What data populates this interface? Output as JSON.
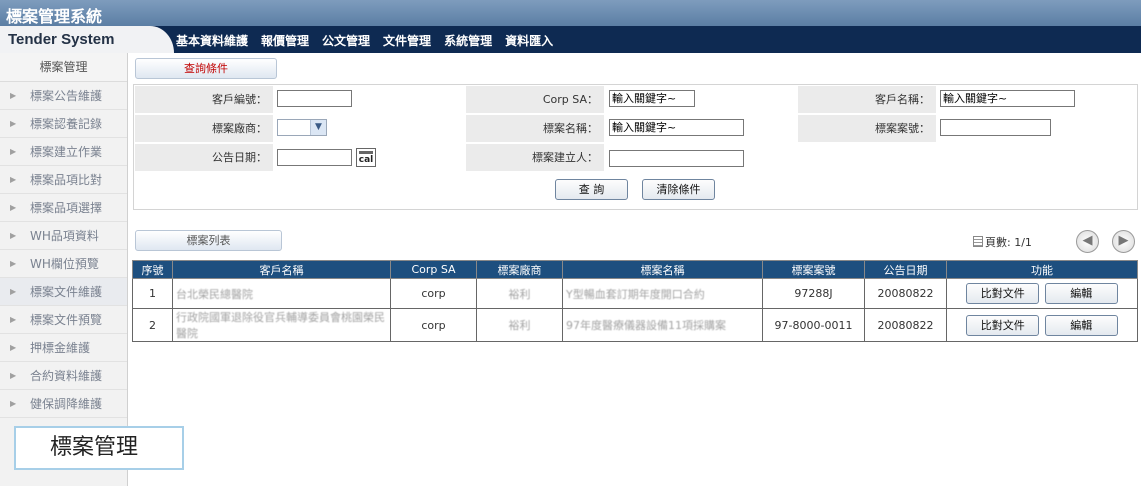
{
  "app": {
    "title": "標案管理系統",
    "brand": "Tender System"
  },
  "nav": {
    "items": [
      "基本資料維護",
      "報價管理",
      "公文管理",
      "文件管理",
      "系統管理",
      "資料匯入"
    ]
  },
  "sidebar": {
    "title": "標案管理",
    "items": [
      {
        "label": "標案公告維護"
      },
      {
        "label": "標案認養記錄"
      },
      {
        "label": "標案建立作業"
      },
      {
        "label": "標案品項比對"
      },
      {
        "label": "標案品項選擇"
      },
      {
        "label": "WH品項資料"
      },
      {
        "label": "WH欄位預覽"
      },
      {
        "label": "標案文件維護",
        "active": true
      },
      {
        "label": "標案文件預覽"
      },
      {
        "label": "押標金維護"
      },
      {
        "label": "合約資料維護"
      },
      {
        "label": "健保調降維護"
      }
    ]
  },
  "tooltip": {
    "label": "標案管理"
  },
  "query": {
    "tab_label": "查詢條件",
    "customer_no_label": "客戶編號：",
    "corp_sa_label": "Corp SA：",
    "corp_sa_value": "輸入關鍵字~",
    "customer_name_label": "客戶名稱：",
    "customer_name_value": "輸入關鍵字~",
    "vendor_label": "標案廠商：",
    "case_name_label": "標案名稱：",
    "case_name_value": "輸入關鍵字~",
    "case_no_label": "標案案號：",
    "announce_date_label": "公告日期：",
    "calendar_icon_text": "cal",
    "creator_label": "標案建立人：",
    "search_button": "查 詢",
    "clear_button": "清除條件"
  },
  "list": {
    "tab_label": "標案列表",
    "page_info": "頁數: 1/1",
    "columns": [
      "序號",
      "客戶名稱",
      "Corp SA",
      "標案廠商",
      "標案名稱",
      "標案案號",
      "公告日期",
      "功能"
    ],
    "rows": [
      {
        "no": "1",
        "customer": "台北榮民總醫院",
        "corp_sa": "corp",
        "vendor": "裕利",
        "case_name": "Y型暢血套訂期年度開口合約",
        "case_no": "97288J",
        "date": "20080822",
        "compare": "比對文件",
        "edit": "編輯"
      },
      {
        "no": "2",
        "customer": "行政院國軍退除役官兵輔導委員會桃園榮民醫院",
        "corp_sa": "corp",
        "vendor": "裕利",
        "case_name": "97年度醫療儀器設備11項採購案",
        "case_no": "97-8000-0011",
        "date": "20080822",
        "compare": "比對文件",
        "edit": "編輯"
      }
    ]
  }
}
